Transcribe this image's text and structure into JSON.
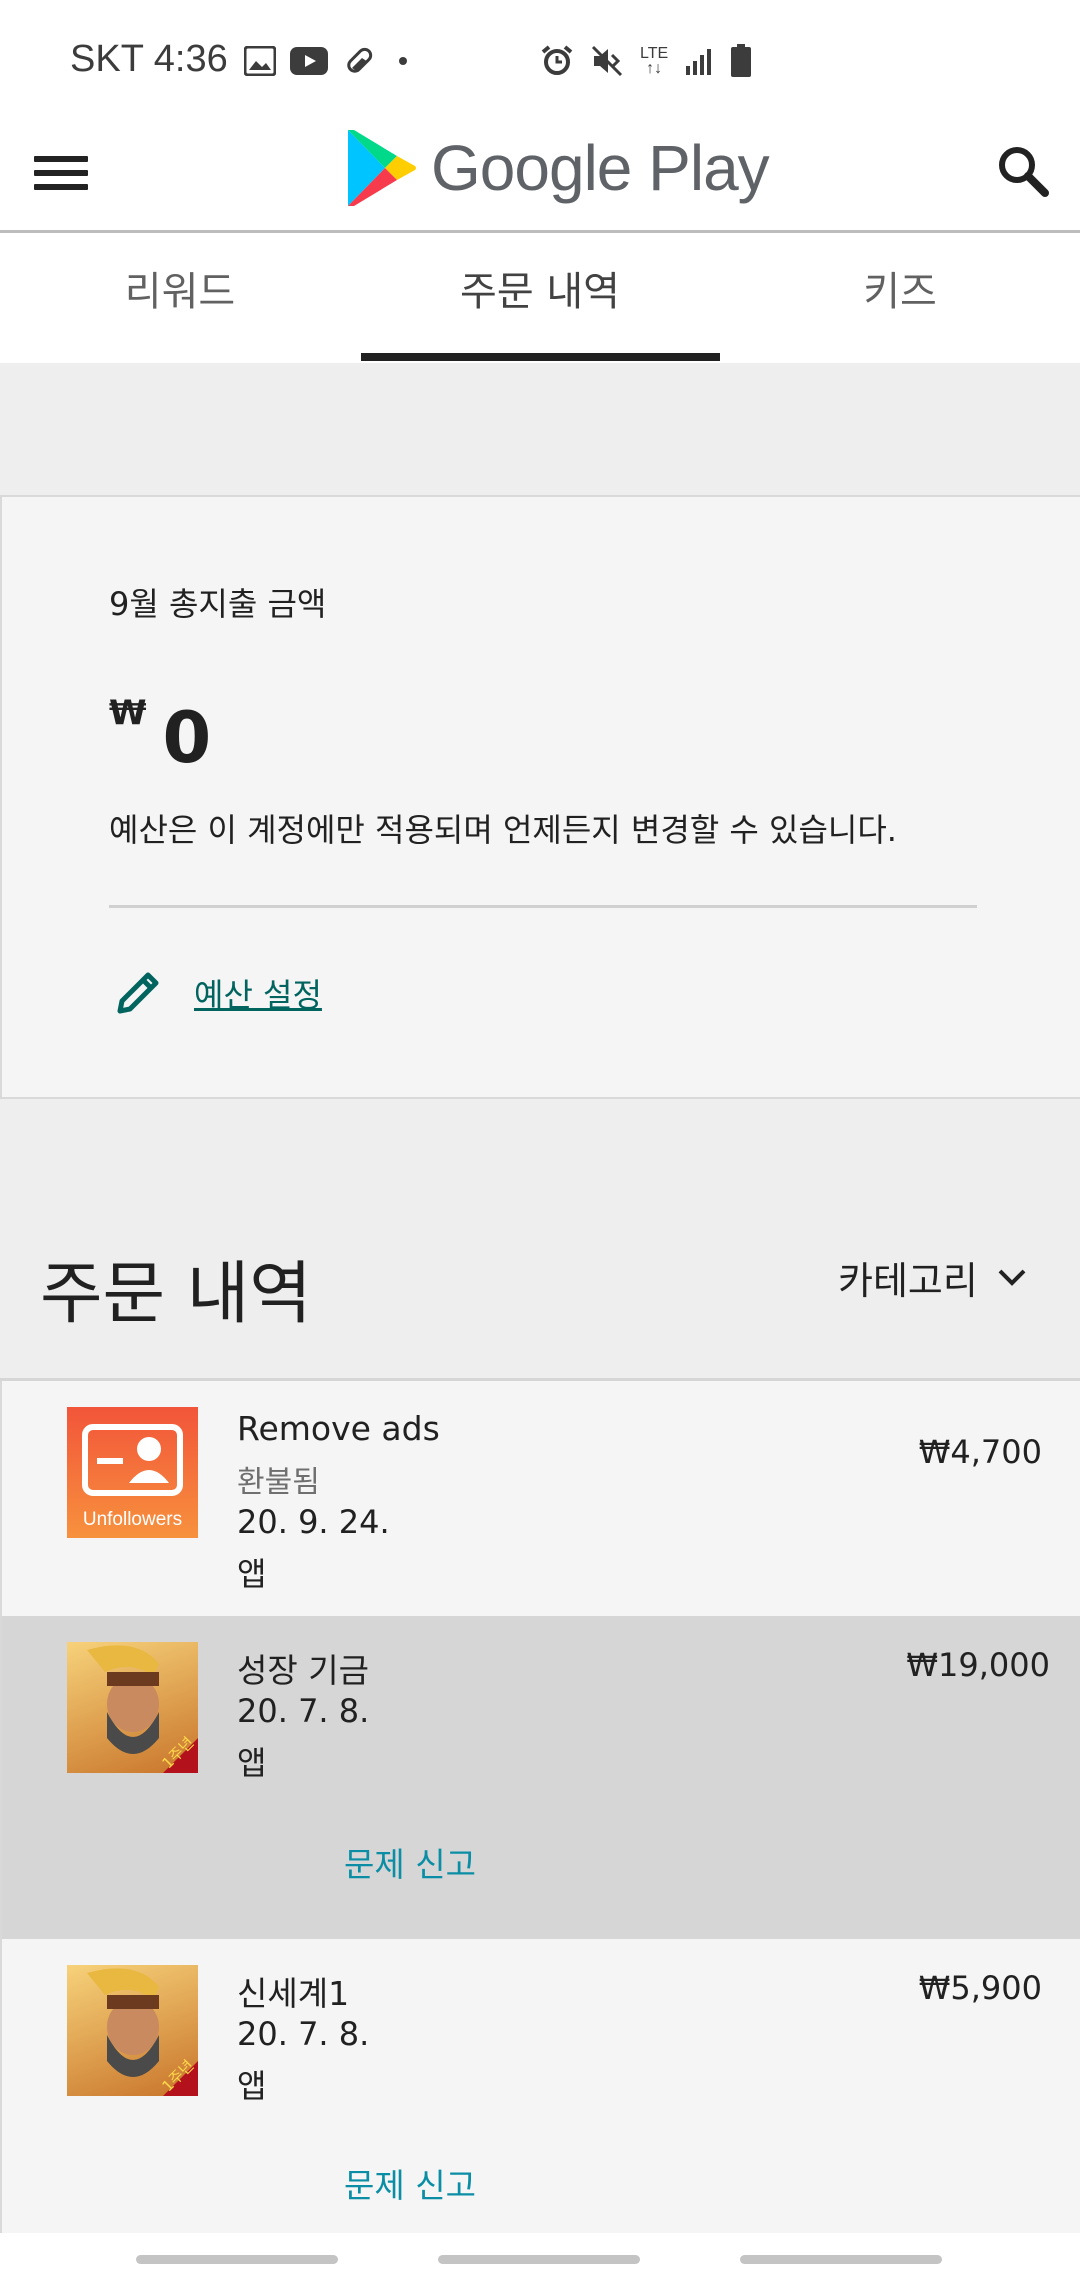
{
  "status_bar": {
    "carrier_time": "SKT 4:36",
    "network_type": "LTE",
    "left_icons": [
      "gallery-icon",
      "youtube-icon",
      "pill-icon",
      "dot-icon"
    ],
    "right_icons": [
      "alarm-icon",
      "mute-icon",
      "lte-icon",
      "signal-icon",
      "battery-icon"
    ]
  },
  "app_bar": {
    "logo_text": "Google Play",
    "menu_icon": "menu-icon",
    "search_icon": "search-icon"
  },
  "tabs": [
    {
      "label": "리워드",
      "active": false
    },
    {
      "label": "주문 내역",
      "active": true
    },
    {
      "label": "키즈",
      "active": false
    }
  ],
  "budget": {
    "title": "9월 총지출 금액",
    "currency": "₩",
    "amount": "0",
    "note": "예산은 이 계정에만 적용되며 언제든지 변경할 수 있습니다.",
    "set_label": "예산 설정"
  },
  "history": {
    "title": "주문 내역",
    "category_label": "카테고리"
  },
  "orders": [
    {
      "title": "Remove ads",
      "status": "환불됨",
      "date": "20. 9. 24.",
      "type": "앱",
      "price": "₩4,700",
      "icon_name": "unfollowers-app-icon",
      "icon_caption": "Unfollowers"
    },
    {
      "title": "성장 기금",
      "date": "20. 7. 8.",
      "type": "앱",
      "price": "₩19,000",
      "report": "문제 신고",
      "icon_name": "rise-of-kingdoms-icon",
      "icon_badge": "1주년"
    },
    {
      "title": "신세계1",
      "date": "20. 7. 8.",
      "type": "앱",
      "price": "₩5,900",
      "report": "문제 신고",
      "icon_name": "rise-of-kingdoms-icon",
      "icon_badge": "1주년"
    }
  ],
  "colors": {
    "accent_teal": "#01645f",
    "report_link": "#0b8ea5",
    "background": "#eeeeee",
    "card": "#f5f5f5",
    "selected_row": "#d6d6d6"
  }
}
